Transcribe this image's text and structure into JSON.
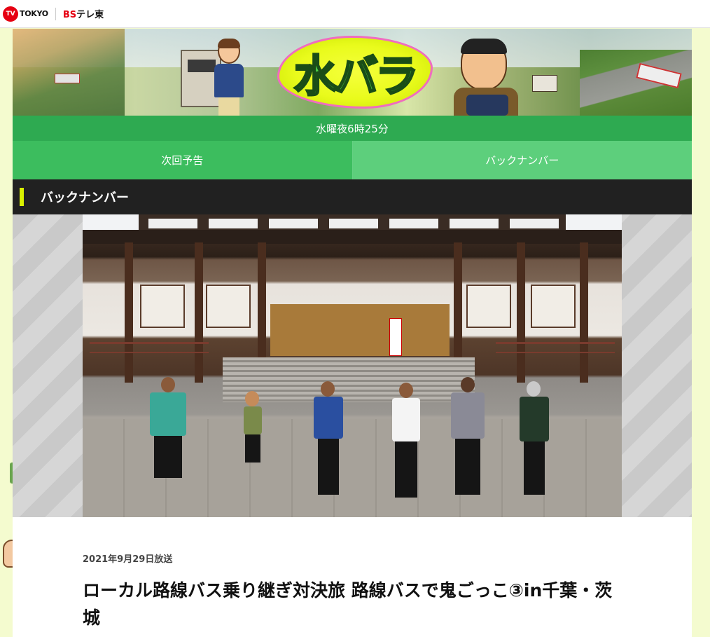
{
  "header": {
    "tv_mark": "TV",
    "tv_text": "TOKYO",
    "bs_prefix": "BS",
    "bs_suffix": "テレ東"
  },
  "banner": {
    "logo_text": "水バラ"
  },
  "airtime": "水曜夜6時25分",
  "nav": {
    "tabs": [
      {
        "label": "次回予告"
      },
      {
        "label": "バックナンバー"
      }
    ]
  },
  "section": {
    "title": "バックナンバー"
  },
  "episode": {
    "air_date": "2021年9月29日放送",
    "title": "ローカル路線バス乗り継ぎ対決旅 路線バスで鬼ごっこ③in千葉・茨城"
  },
  "colors": {
    "green_dark": "#2eaa51",
    "green_tab": "#3cbd5e",
    "green_tab_light": "#5dcf7c",
    "section_bg": "#212121",
    "accent_yellow": "#d9f000",
    "page_bg": "#f4fbcf",
    "brand_red": "#e60012"
  }
}
